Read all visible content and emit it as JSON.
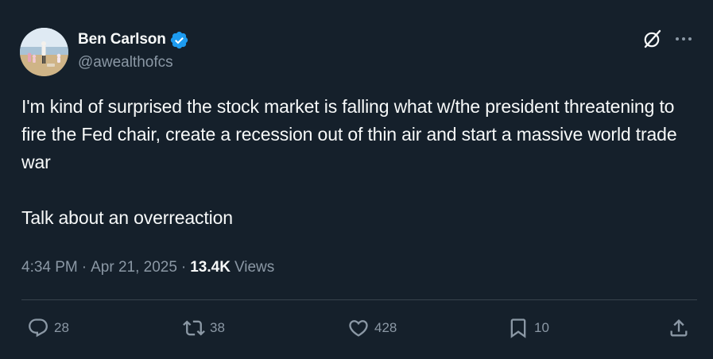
{
  "author": {
    "display_name": "Ben Carlson",
    "handle": "@awealthofcs",
    "verified": true
  },
  "tweet": {
    "text": "I'm kind of surprised the stock market is falling what w/the president threatening to fire the Fed chair, create a recession out of thin air and start a massive world trade war\n\nTalk about an overreaction",
    "time": "4:34 PM",
    "date": "Apr 21, 2025",
    "views_count": "13.4K",
    "views_label": "Views",
    "separator": "·"
  },
  "actions": {
    "reply_count": "28",
    "retweet_count": "38",
    "like_count": "428",
    "bookmark_count": "10"
  },
  "icons": {
    "verified": "verified-badge-icon",
    "grok": "grok-icon",
    "more": "more-horizontal-icon",
    "reply": "reply-icon",
    "retweet": "retweet-icon",
    "like": "heart-icon",
    "bookmark": "bookmark-icon",
    "share": "share-icon"
  },
  "colors": {
    "background": "#15202b",
    "text_primary": "#f7f9f9",
    "text_secondary": "#8b98a5",
    "divider": "#38444d",
    "verified_blue": "#1d9bf0"
  }
}
